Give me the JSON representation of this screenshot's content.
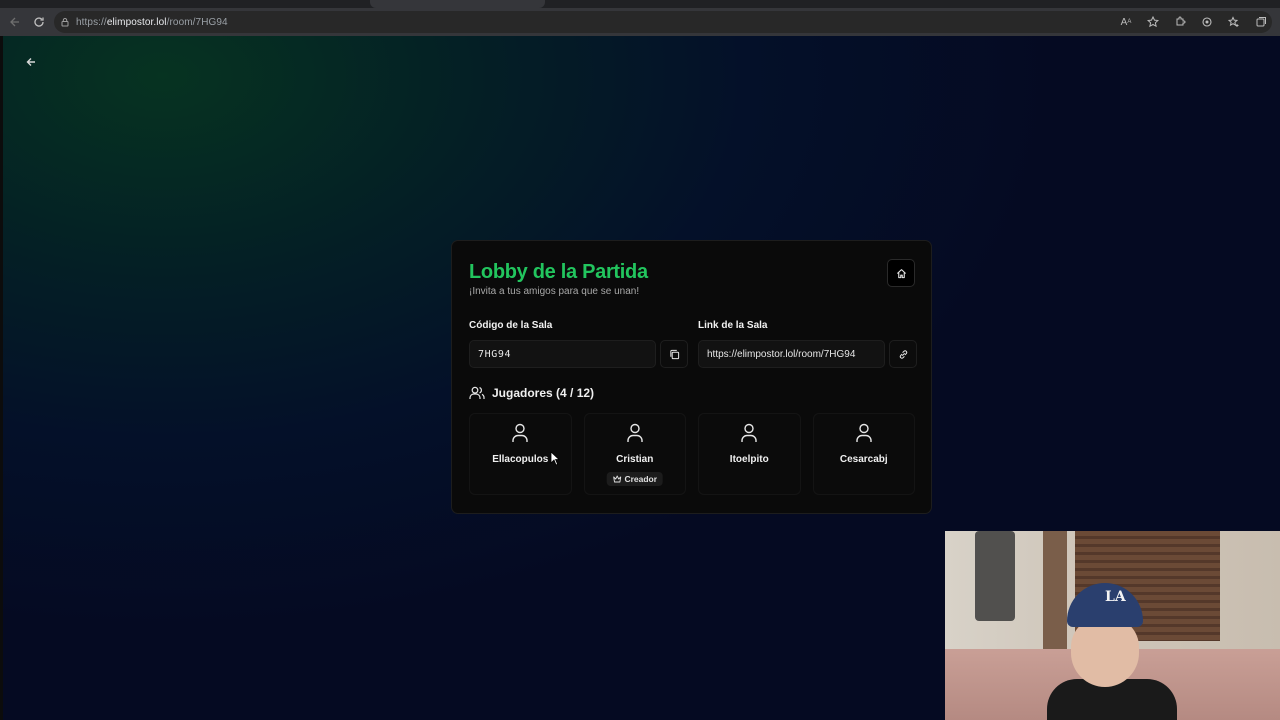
{
  "browser": {
    "url_prefix": "https://",
    "url_domain": "elimpostor.lol",
    "url_path": "/room/7HG94"
  },
  "lobby": {
    "title": "Lobby de la Partida",
    "subtitle": "¡Invita a tus amigos para que se unan!",
    "room_code_label": "Código de la Sala",
    "room_code": "7HG94",
    "room_link_label": "Link de la Sala",
    "room_link": "https://elimpostor.lol/room/7HG94",
    "players_heading": "Jugadores (4 / 12)",
    "accent_color": "#22c55e",
    "players": [
      {
        "name": "Ellacopulos",
        "badge": ""
      },
      {
        "name": "Cristian",
        "badge": "Creador"
      },
      {
        "name": "Itoelpito",
        "badge": ""
      },
      {
        "name": "Cesarcabj",
        "badge": ""
      }
    ]
  },
  "webcam": {
    "cap_logo": "LA"
  }
}
